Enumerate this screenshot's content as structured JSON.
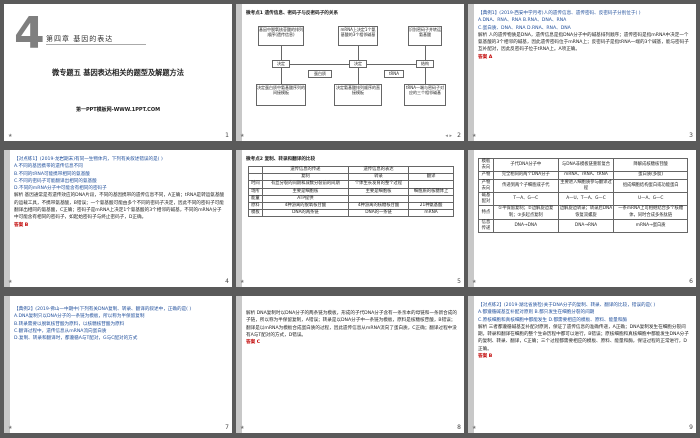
{
  "slides": {
    "s1": {
      "num": "1",
      "big": "4",
      "chapter": "第四章  基因的表达",
      "title": "微专题五  基因表达相关的题型及解题方法",
      "site": "第一PPT模板网-WWW.1PPT.COM"
    },
    "s2": {
      "num": "2",
      "heading": "微考点1  遗传信息、密码子与反密码子的关系",
      "boxes": [
        "基因中脱氧核苷酸的排列顺序(遗传信息)",
        "mRNA上决定1个氨基酸的3个相邻碱基",
        "识别密码子并转运氨基酸",
        "决定",
        "决定",
        "结构",
        "蛋白质",
        "tRNA",
        "决定蛋白质中氨基酸序列的间接模板",
        "决定氨基酸排列顺序的直接模板",
        "tRNA一端与密码子对应的三个相邻碱基"
      ]
    },
    "s3": {
      "num": "3",
      "lines": [
        "【典例1】(2019·西安中学月考)人的遗传信息、遗传密码、反密码子分别位于(    )",
        "A.DNA、RNA、RNA                    B.RNA、DNA、RNA",
        "C.蛋白质、DNA、RNA                 D.RNA、RNA、DNA",
        "解析  人的遗传物质是DNA，遗传信息是指DNA分子中的碱基排列顺序；遗传密码是指mRNA中决定一个氨基酸的3个相邻的碱基，因此遗传密码位于mRNA上；反密码子是指tRNA一端的3个碱基，能与密码子互补配对，因此反密码子位于tRNA上。A项正确。"
      ],
      "answer": "答案  A"
    },
    "s4": {
      "num": "4",
      "lines": [
        "【对点练1】(2019·龙岩期末)有同一生物体内，下列有关叙述错误的是(    )",
        "A.不同的基因携带的遗传信息不同",
        "B.不同的tRNA可能携带相同的氨基酸",
        "C.不同的密码子可能翻译出相同的氨基酸",
        "D.不同的mRNA分子中可能含有相同的密码子",
        "解析  基因通常是有遗传效应的DNA片段，不同的基因携带的遗传信息不同，A正确；tRNA是转运氨基酸的运载工具，不携带氨基酸，B错误；一个氨基酸可能由多个不同的密码子决定，因此不同的密码子可能翻译出相同的氨基酸，C正确；密码子是mRNA上决定1个氨基酸的3个相邻的碱基，不同的mRNA分子中可能含有相同的密码子，如起始密码子与终止密码子，D正确。"
      ],
      "answer": "答案  B"
    },
    "s5": {
      "num": "5",
      "heading": "微考点2  复制、转录和翻译的比较",
      "rows": [
        [
          "",
          "遗传信息的传递",
          "遗传信息的表达",
          ""
        ],
        [
          "",
          "复制",
          "转录",
          "翻译"
        ],
        [
          "时间",
          "有丝分裂的间期和减数分裂前的间期",
          "个体生长发育的整个过程",
          ""
        ],
        [
          "场所",
          "主要是细胞核",
          "主要是细胞核",
          "细胞质的核糖体上"
        ],
        [
          "能量",
          "ATP提供",
          "",
          ""
        ],
        [
          "原料",
          "4种游离的脱氧核苷酸",
          "4种游离的核糖核苷酸",
          "21种氨基酸"
        ],
        [
          "模板",
          "DNA的两条链",
          "DNA的一条链",
          "mRNA"
        ]
      ]
    },
    "s6": {
      "num": "6",
      "rows": [
        [
          "模板去向",
          "子代DNA分子中",
          "与DNA非模板链重新复合",
          "降解成核糖核苷酸"
        ],
        [
          "产物",
          "完全相同的两个DNA分子",
          "mRNA、rRNA、tRNA",
          "蛋白质(多肽)"
        ],
        [
          "产物去向",
          "传递到两个子细胞或子代",
          "主要进入细胞质参与翻译过程",
          "组成细胞结构蛋白或功能蛋白"
        ],
        [
          "碱基配对",
          "T—A、G—C",
          "A—U、T—A、G—C",
          "U—A、G—C"
        ],
        [
          "特点",
          "①半保留复制；②边解旋边复制；③多起点复制",
          "边解旋边转录；转录后DNA恢复双螺旋",
          "一条mRNA上可相继结合多个核糖体，同时合成多条肽链"
        ],
        [
          "信息传递",
          "DNA→DNA",
          "DNA→RNA",
          "mRNA→蛋白质"
        ]
      ]
    },
    "s7": {
      "num": "7",
      "lines": [
        "【典例2】(2019·佛山一中期中)下列有关DNA复制、转录、翻译的叙述中，正确的是(    )",
        "A.DNA复制只以DNA分子的一条链为模板，所以称为半保留复制",
        "B.转录需要以脱氧核苷酸为原料，以核糖核苷酸为原料",
        "C.翻译过程中，遗传信息从mRNA流向蛋白质",
        "D.复制、转录和翻译时，都遵循A与T配对，G与C配对的方式"
      ]
    },
    "s8": {
      "num": "8",
      "lines": [
        "解析  DNA复制时以DNA分子的两条链为模板，形成的子代DNA分子含有一条亲本的母链和一条新合成的子链，所以称为半保留复制，A错误；转录是以DNA分子中一条链为模板，原料是核糖核苷酸，B错误；翻译是以mRNA为模板合成蛋白质的过程，因此遗传信息从mRNA流向了蛋白质，C正确；翻译过程中没有A与T配对的方式，D错误。"
      ],
      "answer": "答案  C"
    },
    "s9": {
      "num": "9",
      "lines": [
        "【对点练2】(2019·湖北省质检)关于DNA分子的复制、转录、翻译的比较，错误的是(    )",
        "A.都遵循碱基互补配对原则        B.都只发生在细胞分裂的间期",
        "C.原核细胞和真核细胞中都能发生  D.都需要相应的模板、原料、能量和酶",
        "解析  三者都遵循碱基互补配对原则，保证了遗传信息的准确传递，A正确；DNA复制发生在细胞分裂间期，转录和翻译在细胞的整个生命历程中都可以进行，B错误；原核细胞和真核细胞中都能发生DNA分子的复制、转录、翻译，C正确；三个过程都需要相应的模板、原料、能量和酶，保证过程的正常进行，D正确。"
      ],
      "answer": "答案  B"
    }
  }
}
